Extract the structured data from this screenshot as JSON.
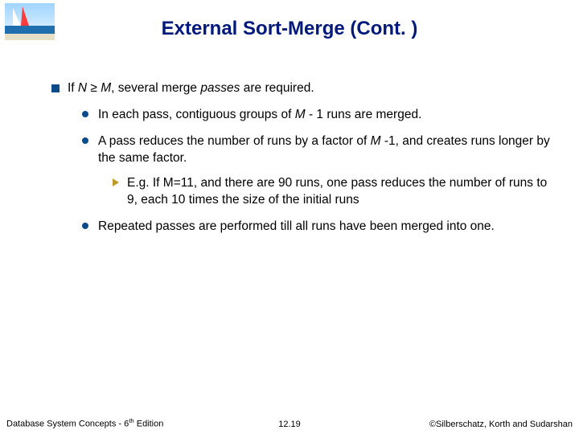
{
  "title": "External Sort-Merge (Cont. )",
  "bullets": {
    "l1": {
      "pre": "If ",
      "var1": "N",
      "mid": " ≥ ",
      "var2": "M",
      "post": ", several merge ",
      "em": "passes",
      "tail": " are required."
    },
    "l2a": {
      "pre": "In each pass, contiguous groups of ",
      "var": "M",
      "post": " - 1 runs are merged."
    },
    "l2b": {
      "pre": "A pass reduces the number of runs by a factor of ",
      "var": "M",
      "post": " -1, and creates runs longer by the same factor."
    },
    "l3": "E.g.  If M=11, and there are 90 runs, one pass reduces the number of runs to 9, each 10 times the size of the initial runs",
    "l2c": "Repeated passes are performed till all runs have been merged into one."
  },
  "footer": {
    "left_pre": "Database System Concepts - 6",
    "left_sup": "th",
    "left_post": " Edition",
    "center": "12.19",
    "right": "©Silberschatz, Korth and Sudarshan"
  }
}
